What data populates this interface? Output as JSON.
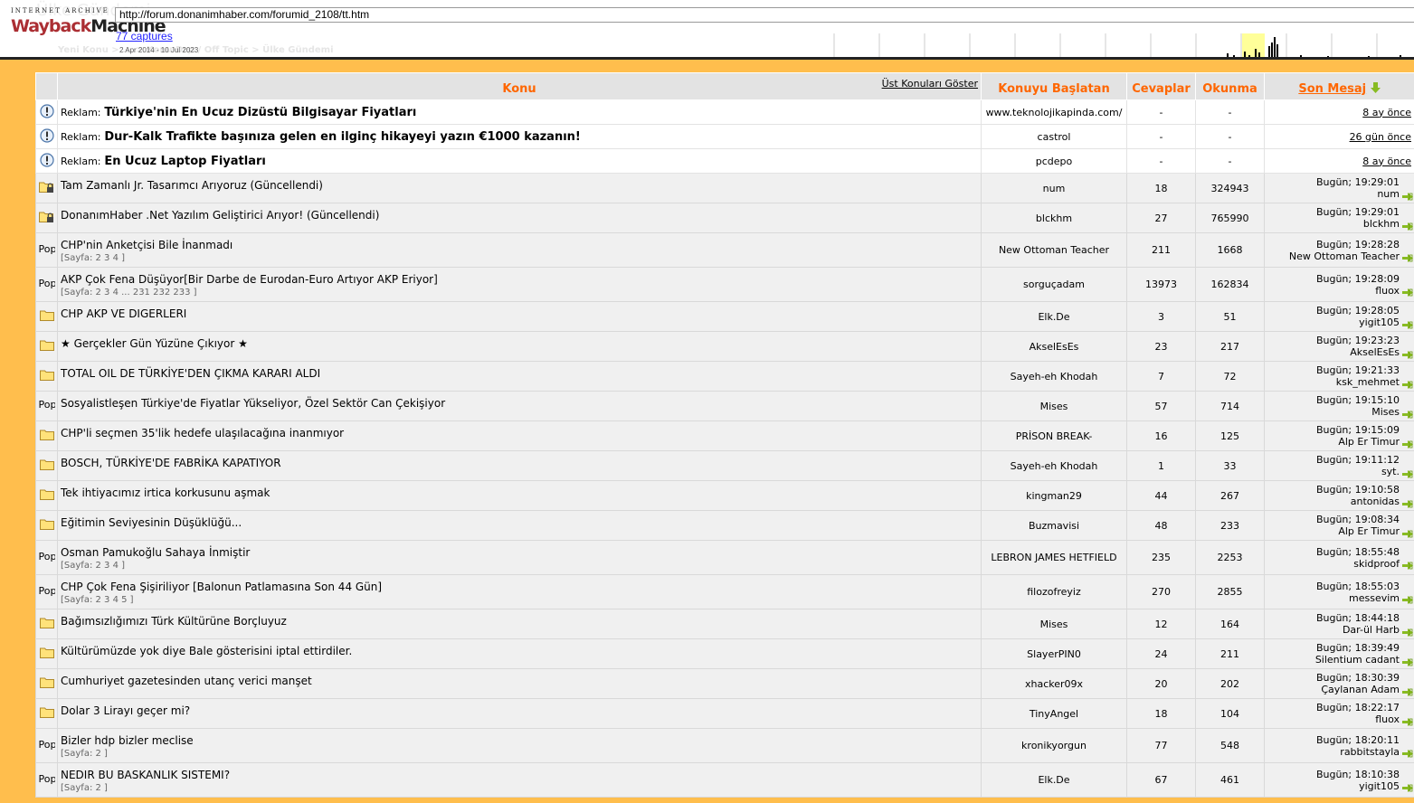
{
  "wayback": {
    "logo_top": "INTERNET ARCHIVE",
    "logo_w1": "Wayback",
    "logo_w2": "Machine",
    "url": "http://forum.donanimhaber.com/forumid_2108/tt.htm",
    "captures": "77 captures",
    "range": "2 Apr 2014 - 10 Jul 2023",
    "ghost_title": "Ülke Gündemi",
    "ghost_crumb": "Yeni Konu > ... > Konu Dışı / Off Topic > Ülke Gündemi"
  },
  "header": {
    "topic": "Konu",
    "show_top": "Üst Konuları Göster",
    "starter": "Konuyu Başlatan",
    "replies": "Cevaplar",
    "views": "Okunma",
    "last_post": "Son Mesaj"
  },
  "ads": [
    {
      "label": "Reklam:",
      "title": "Türkiye'nin En Ucuz Dizüstü Bilgisayar Fiyatları",
      "starter": "www.teknolojikapinda.com/",
      "replies": "-",
      "views": "-",
      "last": "8 ay önce"
    },
    {
      "label": "Reklam:",
      "title": "Dur-Kalk Trafikte başınıza gelen en ilginç hikayeyi yazın €1000 kazanın!",
      "starter": "castrol",
      "replies": "-",
      "views": "-",
      "last": "26 gün önce"
    },
    {
      "label": "Reklam:",
      "title": "En Ucuz Laptop Fiyatları",
      "starter": "pcdepo",
      "replies": "-",
      "views": "-",
      "last": "8 ay önce"
    }
  ],
  "topics": [
    {
      "icon": "locked-folder",
      "title": "Tam Zamanlı Jr. Tasarımcı Arıyoruz (Güncellendi)",
      "pages": "",
      "starter": "num",
      "replies": "18",
      "views": "324943",
      "time": "Bugün; 19:29:01",
      "user": "num"
    },
    {
      "icon": "locked-folder",
      "title": "DonanımHaber .Net Yazılım Geliştirici Arıyor! (Güncellendi)",
      "pages": "",
      "starter": "blckhm",
      "replies": "27",
      "views": "765990",
      "time": "Bugün; 19:29:01",
      "user": "blckhm"
    },
    {
      "icon": "popular",
      "title": "CHP'nin Anketçisi Bile İnanmadı",
      "pages": "[Sayfa: 2 3 4 ]",
      "starter": "New Ottoman Teacher",
      "replies": "211",
      "views": "1668",
      "time": "Bugün; 19:28:28",
      "user": "New Ottoman Teacher"
    },
    {
      "icon": "popular",
      "title": "AKP Çok Fena Düşüyor[Bir Darbe de Eurodan-Euro Artıyor AKP Eriyor]",
      "pages": "[Sayfa: 2 3 4 ... 231 232 233 ]",
      "starter": "sorguçadam",
      "replies": "13973",
      "views": "162834",
      "time": "Bugün; 19:28:09",
      "user": "fluox"
    },
    {
      "icon": "folder",
      "title": "CHP AKP VE DIGERLERI",
      "pages": "",
      "starter": "Elk.De",
      "replies": "3",
      "views": "51",
      "time": "Bugün; 19:28:05",
      "user": "yigit105"
    },
    {
      "icon": "folder",
      "title": "★ Gerçekler Gün Yüzüne Çıkıyor ★",
      "pages": "",
      "starter": "AkselEsEs",
      "replies": "23",
      "views": "217",
      "time": "Bugün; 19:23:23",
      "user": "AkselEsEs"
    },
    {
      "icon": "folder",
      "title": "TOTAL OIL DE TÜRKİYE'DEN ÇIKMA KARARI ALDI",
      "pages": "",
      "starter": "Sayeh-eh Khodah",
      "replies": "7",
      "views": "72",
      "time": "Bugün; 19:21:33",
      "user": "ksk_mehmet"
    },
    {
      "icon": "popular",
      "title": "Sosyalistleşen Türkiye'de Fiyatlar Yükseliyor, Özel Sektör Can Çekişiyor",
      "pages": "",
      "starter": "Mises",
      "replies": "57",
      "views": "714",
      "time": "Bugün; 19:15:10",
      "user": "Mises"
    },
    {
      "icon": "folder",
      "title": "CHP'li seçmen 35'lik hedefe ulaşılacağına inanmıyor",
      "pages": "",
      "starter": "PRİSON BREAK-",
      "replies": "16",
      "views": "125",
      "time": "Bugün; 19:15:09",
      "user": "Alp Er Timur"
    },
    {
      "icon": "folder",
      "title": "BOSCH, TÜRKİYE'DE FABRİKA KAPATIYOR",
      "pages": "",
      "starter": "Sayeh-eh Khodah",
      "replies": "1",
      "views": "33",
      "time": "Bugün; 19:11:12",
      "user": "syt."
    },
    {
      "icon": "folder",
      "title": "Tek ihtiyacımız irtica korkusunu aşmak",
      "pages": "",
      "starter": "kingman29",
      "replies": "44",
      "views": "267",
      "time": "Bugün; 19:10:58",
      "user": "antonidas"
    },
    {
      "icon": "folder",
      "title": "Eğitimin Seviyesinin Düşüklüğü...",
      "pages": "",
      "starter": "Buzmavisi",
      "replies": "48",
      "views": "233",
      "time": "Bugün; 19:08:34",
      "user": "Alp Er Timur"
    },
    {
      "icon": "popular",
      "title": "Osman Pamukoğlu Sahaya İnmiştir",
      "pages": "[Sayfa: 2 3 4 ]",
      "starter": "LEBRON JAMES HETFIELD",
      "replies": "235",
      "views": "2253",
      "time": "Bugün; 18:55:48",
      "user": "skidproof"
    },
    {
      "icon": "popular",
      "title": "CHP Çok Fena Şişiriliyor [Balonun Patlamasına Son 44 Gün]",
      "pages": "[Sayfa: 2 3 4 5 ]",
      "starter": "filozofreyiz",
      "replies": "270",
      "views": "2855",
      "time": "Bugün; 18:55:03",
      "user": "messevim"
    },
    {
      "icon": "folder",
      "title": "Bağımsızlığımızı Türk Kültürüne Borçluyuz",
      "pages": "",
      "starter": "Mises",
      "replies": "12",
      "views": "164",
      "time": "Bugün; 18:44:18",
      "user": "Dar-ül Harb"
    },
    {
      "icon": "folder",
      "title": "Kültürümüzde yok diye Bale gösterisini iptal ettirdiler.",
      "pages": "",
      "starter": "SlayerPIN0",
      "replies": "24",
      "views": "211",
      "time": "Bugün; 18:39:49",
      "user": "Silentium cadant"
    },
    {
      "icon": "folder",
      "title": "Cumhuriyet gazetesinden utanç verici manşet",
      "pages": "",
      "starter": "xhacker09x",
      "replies": "20",
      "views": "202",
      "time": "Bugün; 18:30:39",
      "user": "Çaylanan Adam"
    },
    {
      "icon": "folder",
      "title": "Dolar 3 Lirayı geçer mi?",
      "pages": "",
      "starter": "TinyAngel",
      "replies": "18",
      "views": "104",
      "time": "Bugün; 18:22:17",
      "user": "fluox"
    },
    {
      "icon": "popular",
      "title": "Bizler hdp bizler meclise",
      "pages": "[Sayfa: 2 ]",
      "starter": "kronikyorgun",
      "replies": "77",
      "views": "548",
      "time": "Bugün; 18:20:11",
      "user": "rabbitstayla"
    },
    {
      "icon": "popular",
      "title": "NEDIR BU BASKANLIK SISTEMI?",
      "pages": "[Sayfa: 2 ]",
      "starter": "Elk.De",
      "replies": "67",
      "views": "461",
      "time": "Bugün; 18:10:38",
      "user": "yigit105"
    }
  ],
  "popular_label": "Popüler"
}
